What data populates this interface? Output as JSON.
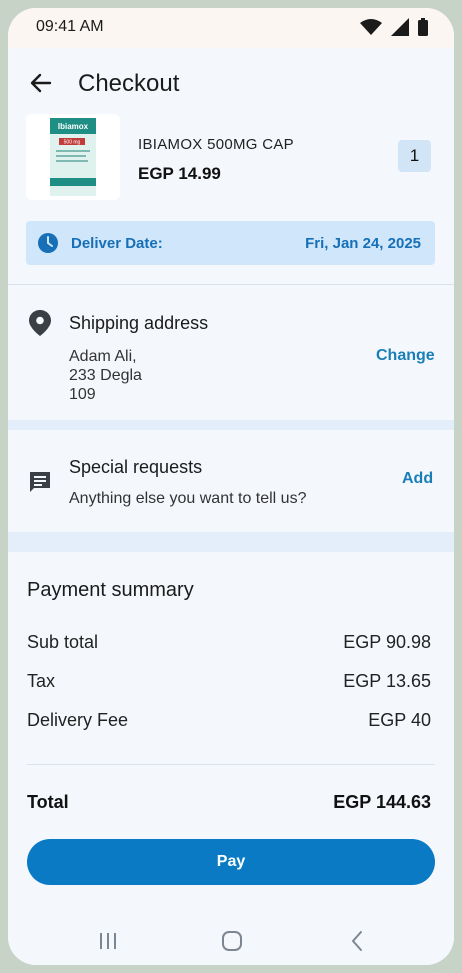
{
  "status_bar": {
    "time": "09:41 AM"
  },
  "header": {
    "title": "Checkout"
  },
  "product": {
    "name": "IBIAMOX 500MG CAP",
    "price": "EGP 14.99",
    "quantity": "1",
    "thumbnail_brand": "Ibiamox",
    "thumbnail_dose": "500 mg"
  },
  "delivery": {
    "label": "Deliver Date:",
    "value": "Fri, Jan 24, 2025"
  },
  "shipping": {
    "title": "Shipping address",
    "address_line1": "Adam Ali,",
    "address_line2": "233 Degla",
    "address_line3": "109",
    "change_label": "Change"
  },
  "special_requests": {
    "title": "Special requests",
    "subtitle": "Anything else you want to tell us?",
    "add_label": "Add"
  },
  "payment": {
    "title": "Payment summary",
    "rows": [
      {
        "label": "Sub total",
        "value": "EGP 90.98"
      },
      {
        "label": "Tax",
        "value": "EGP 13.65"
      },
      {
        "label": "Delivery Fee",
        "value": "EGP 40"
      }
    ],
    "total_label": "Total",
    "total_value": "EGP 144.63"
  },
  "pay_button": {
    "label": "Pay"
  },
  "colors": {
    "accent": "#0a7ac4",
    "link": "#1a7fb8",
    "delivery_bg": "#cfe6fb",
    "delivery_text": "#1770b7",
    "frame": "#c7d3c6"
  },
  "icons": {
    "back": "arrow-left-icon",
    "clock": "clock-icon",
    "location": "location-pin-icon",
    "message": "message-icon",
    "wifi": "wifi-icon",
    "signal": "signal-icon",
    "battery": "battery-icon",
    "nav_recent": "recent-apps-icon",
    "nav_home": "home-icon",
    "nav_back": "nav-back-icon"
  }
}
